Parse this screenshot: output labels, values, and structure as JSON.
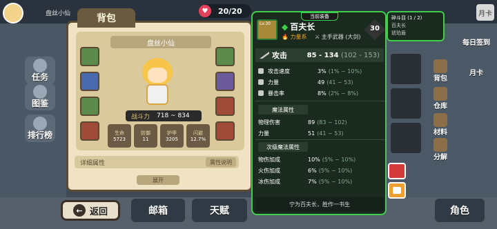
{
  "header": {
    "player_name": "盘丝小仙",
    "hp": "20/20",
    "menu_label": "月卡"
  },
  "bag": {
    "tab_title": "背包",
    "character_name": "盘丝小仙",
    "power_label": "战斗力",
    "power_value": "718 ~ 834",
    "stats": [
      {
        "label": "生命",
        "value": "5723"
      },
      {
        "label": "防御",
        "value": "11"
      },
      {
        "label": "护甲",
        "value": "3205"
      },
      {
        "label": "闪避",
        "value": "12.7%"
      }
    ],
    "detail_label": "详细属性",
    "detail_button": "属性说明",
    "expand_label": "展开"
  },
  "side_menu": {
    "task": "任务",
    "guide": "图鉴",
    "rank": "排行榜"
  },
  "bottom": {
    "back": "返回",
    "mail": "邮箱",
    "talent": "天赋",
    "role": "角色"
  },
  "right_menu": {
    "daily_sign": "每日签到",
    "monthly": "月卡",
    "bag": "背包",
    "warehouse": "仓库",
    "material": "材料",
    "decompose": "分解"
  },
  "tooltip": {
    "badge": "当前装备",
    "level": "Lv.30",
    "name": "百夫长",
    "tag": "力量系",
    "type": "主手武器 (大剑)",
    "tier": "30",
    "attack_label": "攻击",
    "attack_value": "85 - 134",
    "attack_range": "(102 - 153)",
    "base_stats": [
      {
        "name": "攻击速度",
        "value": "3%",
        "range": "(1% ~ 10%)"
      },
      {
        "name": "力量",
        "value": "49",
        "range": "(41 ~ 53)"
      },
      {
        "name": "暴击率",
        "value": "8%",
        "range": "(2% ~ 8%)"
      }
    ],
    "magic_section": "魔法属性",
    "magic_stats": [
      {
        "name": "物理伤害",
        "value": "89",
        "range": "(83 ~ 102)"
      },
      {
        "name": "力量",
        "value": "51",
        "range": "(41 ~ 53)"
      }
    ],
    "sub_magic_section": "次级魔法属性",
    "sub_magic_stats": [
      {
        "name": "物伤加成",
        "value": "10%",
        "range": "(5% ~ 10%)"
      },
      {
        "name": "火伤加成",
        "value": "6%",
        "range": "(5% ~ 10%)"
      },
      {
        "name": "冰伤加成",
        "value": "7%",
        "range": "(5% ~ 10%)"
      }
    ],
    "footer": "宁为百夫长，胜作一书生"
  },
  "tooltip2": {
    "title": "碎斗目 (1 / 2)",
    "line1": "百夫长",
    "line2": "琥珀盾"
  },
  "colors": {
    "rarity_green": "#3fd04a",
    "tag_orange": "#f0a030"
  }
}
